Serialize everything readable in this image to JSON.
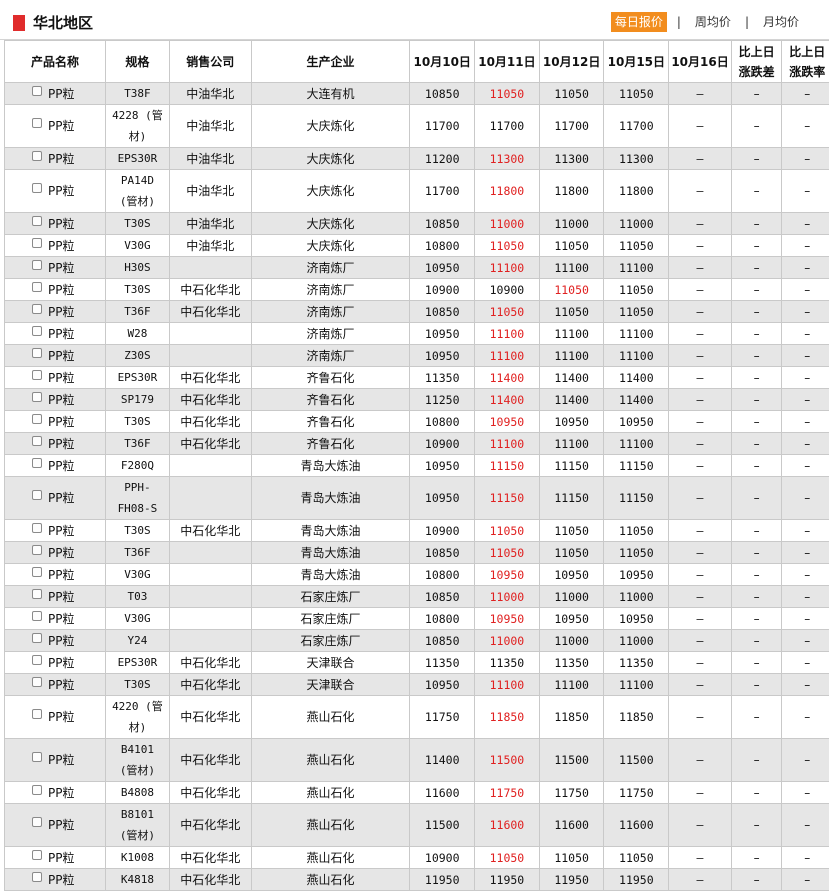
{
  "header": {
    "title": "华北地区",
    "tabs": [
      {
        "label": "每日报价",
        "active": true
      },
      {
        "label": "周均价",
        "active": false
      },
      {
        "label": "月均价",
        "active": false
      }
    ],
    "separator": "|"
  },
  "table": {
    "columns": [
      "产品名称",
      "规格",
      "销售公司",
      "生产企业",
      "10月10日",
      "10月11日",
      "10月12日",
      "10月15日",
      "10月16日",
      "比上日涨跌差",
      "比上日涨跌率"
    ],
    "column_lines": {
      "change_diff": [
        "比上日",
        "涨跌差"
      ],
      "change_rate": [
        "比上日",
        "涨跌率"
      ]
    },
    "highlight_color": "#e02020",
    "rows": [
      {
        "product": "PP粒",
        "spec": "T38F",
        "seller": "中油华北",
        "producer": "大连有机",
        "d1010": "10850",
        "d1011": "11050",
        "d1012": "11050",
        "d1015": "11050",
        "d1016": "–",
        "diff": "–",
        "rate": "–",
        "red": 1
      },
      {
        "product": "PP粒",
        "spec": "4228 (管材)",
        "seller": "中油华北",
        "producer": "大庆炼化",
        "d1010": "11700",
        "d1011": "11700",
        "d1012": "11700",
        "d1015": "11700",
        "d1016": "–",
        "diff": "–",
        "rate": "–",
        "red": 0
      },
      {
        "product": "PP粒",
        "spec": "EPS30R",
        "seller": "中油华北",
        "producer": "大庆炼化",
        "d1010": "11200",
        "d1011": "11300",
        "d1012": "11300",
        "d1015": "11300",
        "d1016": "–",
        "diff": "–",
        "rate": "–",
        "red": 1
      },
      {
        "product": "PP粒",
        "spec": "PA14D (管材)",
        "seller": "中油华北",
        "producer": "大庆炼化",
        "d1010": "11700",
        "d1011": "11800",
        "d1012": "11800",
        "d1015": "11800",
        "d1016": "–",
        "diff": "–",
        "rate": "–",
        "red": 1
      },
      {
        "product": "PP粒",
        "spec": "T30S",
        "seller": "中油华北",
        "producer": "大庆炼化",
        "d1010": "10850",
        "d1011": "11000",
        "d1012": "11000",
        "d1015": "11000",
        "d1016": "–",
        "diff": "–",
        "rate": "–",
        "red": 1
      },
      {
        "product": "PP粒",
        "spec": "V30G",
        "seller": "中油华北",
        "producer": "大庆炼化",
        "d1010": "10800",
        "d1011": "11050",
        "d1012": "11050",
        "d1015": "11050",
        "d1016": "–",
        "diff": "–",
        "rate": "–",
        "red": 1
      },
      {
        "product": "PP粒",
        "spec": "H30S",
        "seller": "",
        "producer": "济南炼厂",
        "d1010": "10950",
        "d1011": "11100",
        "d1012": "11100",
        "d1015": "11100",
        "d1016": "–",
        "diff": "–",
        "rate": "–",
        "red": 1
      },
      {
        "product": "PP粒",
        "spec": "T30S",
        "seller": "中石化华北",
        "producer": "济南炼厂",
        "d1010": "10900",
        "d1011": "10900",
        "d1012": "11050",
        "d1015": "11050",
        "d1016": "–",
        "diff": "–",
        "rate": "–",
        "red": 2
      },
      {
        "product": "PP粒",
        "spec": "T36F",
        "seller": "中石化华北",
        "producer": "济南炼厂",
        "d1010": "10850",
        "d1011": "11050",
        "d1012": "11050",
        "d1015": "11050",
        "d1016": "–",
        "diff": "–",
        "rate": "–",
        "red": 1
      },
      {
        "product": "PP粒",
        "spec": "W28",
        "seller": "",
        "producer": "济南炼厂",
        "d1010": "10950",
        "d1011": "11100",
        "d1012": "11100",
        "d1015": "11100",
        "d1016": "–",
        "diff": "–",
        "rate": "–",
        "red": 1
      },
      {
        "product": "PP粒",
        "spec": "Z30S",
        "seller": "",
        "producer": "济南炼厂",
        "d1010": "10950",
        "d1011": "11100",
        "d1012": "11100",
        "d1015": "11100",
        "d1016": "–",
        "diff": "–",
        "rate": "–",
        "red": 1
      },
      {
        "product": "PP粒",
        "spec": "EPS30R",
        "seller": "中石化华北",
        "producer": "齐鲁石化",
        "d1010": "11350",
        "d1011": "11400",
        "d1012": "11400",
        "d1015": "11400",
        "d1016": "–",
        "diff": "–",
        "rate": "–",
        "red": 1
      },
      {
        "product": "PP粒",
        "spec": "SP179",
        "seller": "中石化华北",
        "producer": "齐鲁石化",
        "d1010": "11250",
        "d1011": "11400",
        "d1012": "11400",
        "d1015": "11400",
        "d1016": "–",
        "diff": "–",
        "rate": "–",
        "red": 1
      },
      {
        "product": "PP粒",
        "spec": "T30S",
        "seller": "中石化华北",
        "producer": "齐鲁石化",
        "d1010": "10800",
        "d1011": "10950",
        "d1012": "10950",
        "d1015": "10950",
        "d1016": "–",
        "diff": "–",
        "rate": "–",
        "red": 1
      },
      {
        "product": "PP粒",
        "spec": "T36F",
        "seller": "中石化华北",
        "producer": "齐鲁石化",
        "d1010": "10900",
        "d1011": "11100",
        "d1012": "11100",
        "d1015": "11100",
        "d1016": "–",
        "diff": "–",
        "rate": "–",
        "red": 1
      },
      {
        "product": "PP粒",
        "spec": "F280Q",
        "seller": "",
        "producer": "青岛大炼油",
        "d1010": "10950",
        "d1011": "11150",
        "d1012": "11150",
        "d1015": "11150",
        "d1016": "–",
        "diff": "–",
        "rate": "–",
        "red": 1
      },
      {
        "product": "PP粒",
        "spec": "PPH-FH08-S",
        "seller": "",
        "producer": "青岛大炼油",
        "d1010": "10950",
        "d1011": "11150",
        "d1012": "11150",
        "d1015": "11150",
        "d1016": "–",
        "diff": "–",
        "rate": "–",
        "red": 1
      },
      {
        "product": "PP粒",
        "spec": "T30S",
        "seller": "中石化华北",
        "producer": "青岛大炼油",
        "d1010": "10900",
        "d1011": "11050",
        "d1012": "11050",
        "d1015": "11050",
        "d1016": "–",
        "diff": "–",
        "rate": "–",
        "red": 1
      },
      {
        "product": "PP粒",
        "spec": "T36F",
        "seller": "",
        "producer": "青岛大炼油",
        "d1010": "10850",
        "d1011": "11050",
        "d1012": "11050",
        "d1015": "11050",
        "d1016": "–",
        "diff": "–",
        "rate": "–",
        "red": 1
      },
      {
        "product": "PP粒",
        "spec": "V30G",
        "seller": "",
        "producer": "青岛大炼油",
        "d1010": "10800",
        "d1011": "10950",
        "d1012": "10950",
        "d1015": "10950",
        "d1016": "–",
        "diff": "–",
        "rate": "–",
        "red": 1
      },
      {
        "product": "PP粒",
        "spec": "T03",
        "seller": "",
        "producer": "石家庄炼厂",
        "d1010": "10850",
        "d1011": "11000",
        "d1012": "11000",
        "d1015": "11000",
        "d1016": "–",
        "diff": "–",
        "rate": "–",
        "red": 1
      },
      {
        "product": "PP粒",
        "spec": "V30G",
        "seller": "",
        "producer": "石家庄炼厂",
        "d1010": "10800",
        "d1011": "10950",
        "d1012": "10950",
        "d1015": "10950",
        "d1016": "–",
        "diff": "–",
        "rate": "–",
        "red": 1
      },
      {
        "product": "PP粒",
        "spec": "Y24",
        "seller": "",
        "producer": "石家庄炼厂",
        "d1010": "10850",
        "d1011": "11000",
        "d1012": "11000",
        "d1015": "11000",
        "d1016": "–",
        "diff": "–",
        "rate": "–",
        "red": 1
      },
      {
        "product": "PP粒",
        "spec": "EPS30R",
        "seller": "中石化华北",
        "producer": "天津联合",
        "d1010": "11350",
        "d1011": "11350",
        "d1012": "11350",
        "d1015": "11350",
        "d1016": "–",
        "diff": "–",
        "rate": "–",
        "red": 0
      },
      {
        "product": "PP粒",
        "spec": "T30S",
        "seller": "中石化华北",
        "producer": "天津联合",
        "d1010": "10950",
        "d1011": "11100",
        "d1012": "11100",
        "d1015": "11100",
        "d1016": "–",
        "diff": "–",
        "rate": "–",
        "red": 1
      },
      {
        "product": "PP粒",
        "spec": "4220 (管材)",
        "seller": "中石化华北",
        "producer": "燕山石化",
        "d1010": "11750",
        "d1011": "11850",
        "d1012": "11850",
        "d1015": "11850",
        "d1016": "–",
        "diff": "–",
        "rate": "–",
        "red": 1
      },
      {
        "product": "PP粒",
        "spec": "B4101 (管材)",
        "seller": "中石化华北",
        "producer": "燕山石化",
        "d1010": "11400",
        "d1011": "11500",
        "d1012": "11500",
        "d1015": "11500",
        "d1016": "–",
        "diff": "–",
        "rate": "–",
        "red": 1
      },
      {
        "product": "PP粒",
        "spec": "B4808",
        "seller": "中石化华北",
        "producer": "燕山石化",
        "d1010": "11600",
        "d1011": "11750",
        "d1012": "11750",
        "d1015": "11750",
        "d1016": "–",
        "diff": "–",
        "rate": "–",
        "red": 1
      },
      {
        "product": "PP粒",
        "spec": "B8101 (管材)",
        "seller": "中石化华北",
        "producer": "燕山石化",
        "d1010": "11500",
        "d1011": "11600",
        "d1012": "11600",
        "d1015": "11600",
        "d1016": "–",
        "diff": "–",
        "rate": "–",
        "red": 1
      },
      {
        "product": "PP粒",
        "spec": "K1008",
        "seller": "中石化华北",
        "producer": "燕山石化",
        "d1010": "10900",
        "d1011": "11050",
        "d1012": "11050",
        "d1015": "11050",
        "d1016": "–",
        "diff": "–",
        "rate": "–",
        "red": 1
      },
      {
        "product": "PP粒",
        "spec": "K4818",
        "seller": "中石化华北",
        "producer": "燕山石化",
        "d1010": "11950",
        "d1011": "11950",
        "d1012": "11950",
        "d1015": "11950",
        "d1016": "–",
        "diff": "–",
        "rate": "–",
        "red": 0
      }
    ]
  }
}
